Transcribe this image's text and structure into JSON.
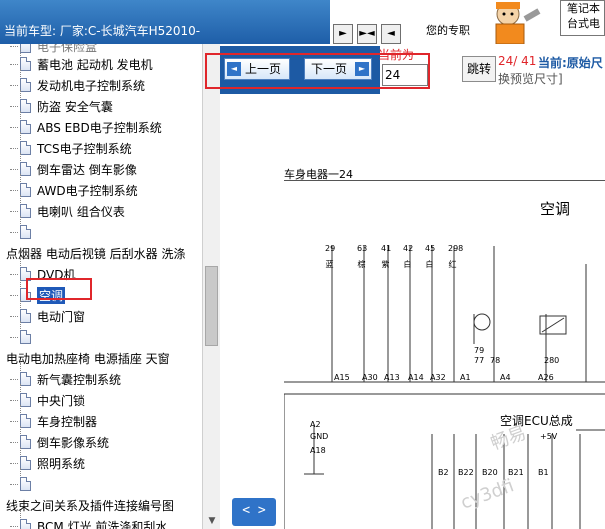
{
  "header": {
    "model_label": "当前车型:  厂家:C-长城汽车H52010-",
    "pro_label": "您的专职",
    "desk_label": "笔记本 台式电"
  },
  "sidebar": {
    "items": [
      {
        "label": "蓄电池 起动机 发电机",
        "type": "doc"
      },
      {
        "label": "发动机电子控制系统",
        "type": "doc"
      },
      {
        "label": "防盗 安全气囊",
        "type": "doc"
      },
      {
        "label": "ABS EBD电子控制系统",
        "type": "doc"
      },
      {
        "label": "TCS电子控制系统",
        "type": "doc"
      },
      {
        "label": "倒车雷达 倒车影像",
        "type": "doc"
      },
      {
        "label": "AWD电子控制系统",
        "type": "doc"
      },
      {
        "label": "电喇叭 组合仪表",
        "type": "doc"
      },
      {
        "label": "",
        "type": "doc"
      },
      {
        "label": "点烟器 电动后视镜 后刮水器 洗涤",
        "type": "folder"
      },
      {
        "label": "DVD机",
        "type": "doc"
      },
      {
        "label": "空调",
        "type": "doc",
        "selected": true
      },
      {
        "label": "电动门窗",
        "type": "doc"
      },
      {
        "label": "",
        "type": "doc"
      },
      {
        "label": "电动电加热座椅 电源插座 天窗",
        "type": "folder"
      },
      {
        "label": "新气囊控制系统",
        "type": "doc"
      },
      {
        "label": "中央门锁",
        "type": "doc"
      },
      {
        "label": "车身控制器",
        "type": "doc"
      },
      {
        "label": "倒车影像系统",
        "type": "doc"
      },
      {
        "label": "照明系统",
        "type": "doc"
      },
      {
        "label": "",
        "type": "doc"
      },
      {
        "label": "线束之间关系及插件连接编号图",
        "type": "folder"
      },
      {
        "label": "BCM 灯光 前洗涤和刮水",
        "type": "doc"
      }
    ]
  },
  "nav": {
    "prev_label": "上一页",
    "next_label": "下一页",
    "current_label": "当前为",
    "page_value": "24",
    "jump_label": "跳转",
    "page_count": "24/ 41",
    "current_page_prefix": "当前:原始尺",
    "preview_size": "换预览尺寸]"
  },
  "document": {
    "header": "车身电器一24",
    "title": "空调",
    "ecu_label": "空调ECU总成",
    "voltage_label": "+5V",
    "gnd_label": "GND",
    "pin_numbers_top": [
      "29",
      "63",
      "41",
      "42",
      "45",
      "298"
    ],
    "pin_colors_top": [
      "蓝",
      "棕",
      "紫",
      "白",
      "白",
      "红"
    ],
    "pin_labels": [
      "A15",
      "A30",
      "A13",
      "A14",
      "A32",
      "A1",
      "A4",
      "A26"
    ],
    "wire_numbers": [
      "79",
      "77",
      "78",
      "280"
    ],
    "ecu_pins": [
      "A2",
      "A18",
      "B2",
      "B22",
      "B20",
      "B21",
      "B1"
    ],
    "toggle_label": "< >"
  },
  "colors": {
    "header_blue": "#1d5aa4",
    "highlight_red": "#e0262b",
    "selection_blue": "#1f59b8"
  }
}
